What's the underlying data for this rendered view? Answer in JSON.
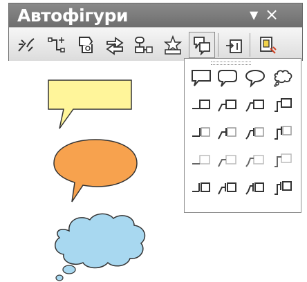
{
  "toolbar": {
    "title": "Автофігури",
    "menu_icon": "dropdown-triangle-icon",
    "close_icon": "close-icon",
    "tools": [
      {
        "name": "lines-tool",
        "icon": "lines-icon"
      },
      {
        "name": "connectors-tool",
        "icon": "connectors-icon"
      },
      {
        "name": "basic-shapes-tool",
        "icon": "basic-shapes-icon"
      },
      {
        "name": "block-arrows-tool",
        "icon": "block-arrows-icon"
      },
      {
        "name": "flowchart-tool",
        "icon": "flowchart-icon"
      },
      {
        "name": "stars-banners-tool",
        "icon": "stars-banners-icon"
      },
      {
        "name": "callouts-tool",
        "icon": "callouts-icon",
        "active": true
      },
      {
        "name": "action-buttons-tool",
        "icon": "action-buttons-icon"
      },
      {
        "name": "more-autoshapes-tool",
        "icon": "more-autoshapes-icon"
      }
    ]
  },
  "callout_panel": {
    "rows": [
      [
        "rect-callout-icon",
        "rounded-rect-callout-icon",
        "oval-callout-icon",
        "cloud-callout-icon"
      ],
      [
        "line-callout-1-icon",
        "line-callout-2-icon",
        "line-callout-3-icon",
        "line-callout-4-icon"
      ],
      [
        "line-callout-1-accent-icon",
        "line-callout-2-accent-icon",
        "line-callout-3-accent-icon",
        "line-callout-4-accent-icon"
      ],
      [
        "line-callout-1-noborder-icon",
        "line-callout-2-noborder-icon",
        "line-callout-3-noborder-icon",
        "line-callout-4-noborder-icon"
      ],
      [
        "line-callout-1-border-accent-icon",
        "line-callout-2-border-accent-icon",
        "line-callout-3-border-accent-icon",
        "line-callout-4-border-accent-icon"
      ]
    ]
  },
  "canvas": {
    "shapes": [
      {
        "name": "rectangular-callout-shape",
        "fill": "#FFF59A"
      },
      {
        "name": "oval-callout-shape",
        "fill": "#F7A24E"
      },
      {
        "name": "cloud-callout-shape",
        "fill": "#A8D8F0"
      }
    ]
  },
  "colors": {
    "titlebar": "#7a7a7a",
    "outline": "#333333"
  }
}
